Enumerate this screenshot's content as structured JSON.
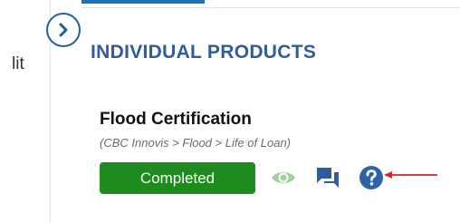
{
  "left_panel": {
    "partial_label": "lit"
  },
  "section": {
    "title": "INDIVIDUAL PRODUCTS"
  },
  "product": {
    "name": "Flood Certification",
    "path": "(CBC Innovis > Flood > Life of Loan)",
    "status": "Completed"
  },
  "icons": {
    "collapse": "chevron-right-icon",
    "view": "eye-icon",
    "comments": "chat-icon",
    "help": "question-icon"
  },
  "colors": {
    "brand_blue": "#2f5c9a",
    "status_green": "#1d8b1d",
    "view_icon": "#9fd39a",
    "chat_icon": "#2f5c9a",
    "help_icon": "#2f63a8",
    "annotation_red": "#d32626"
  }
}
